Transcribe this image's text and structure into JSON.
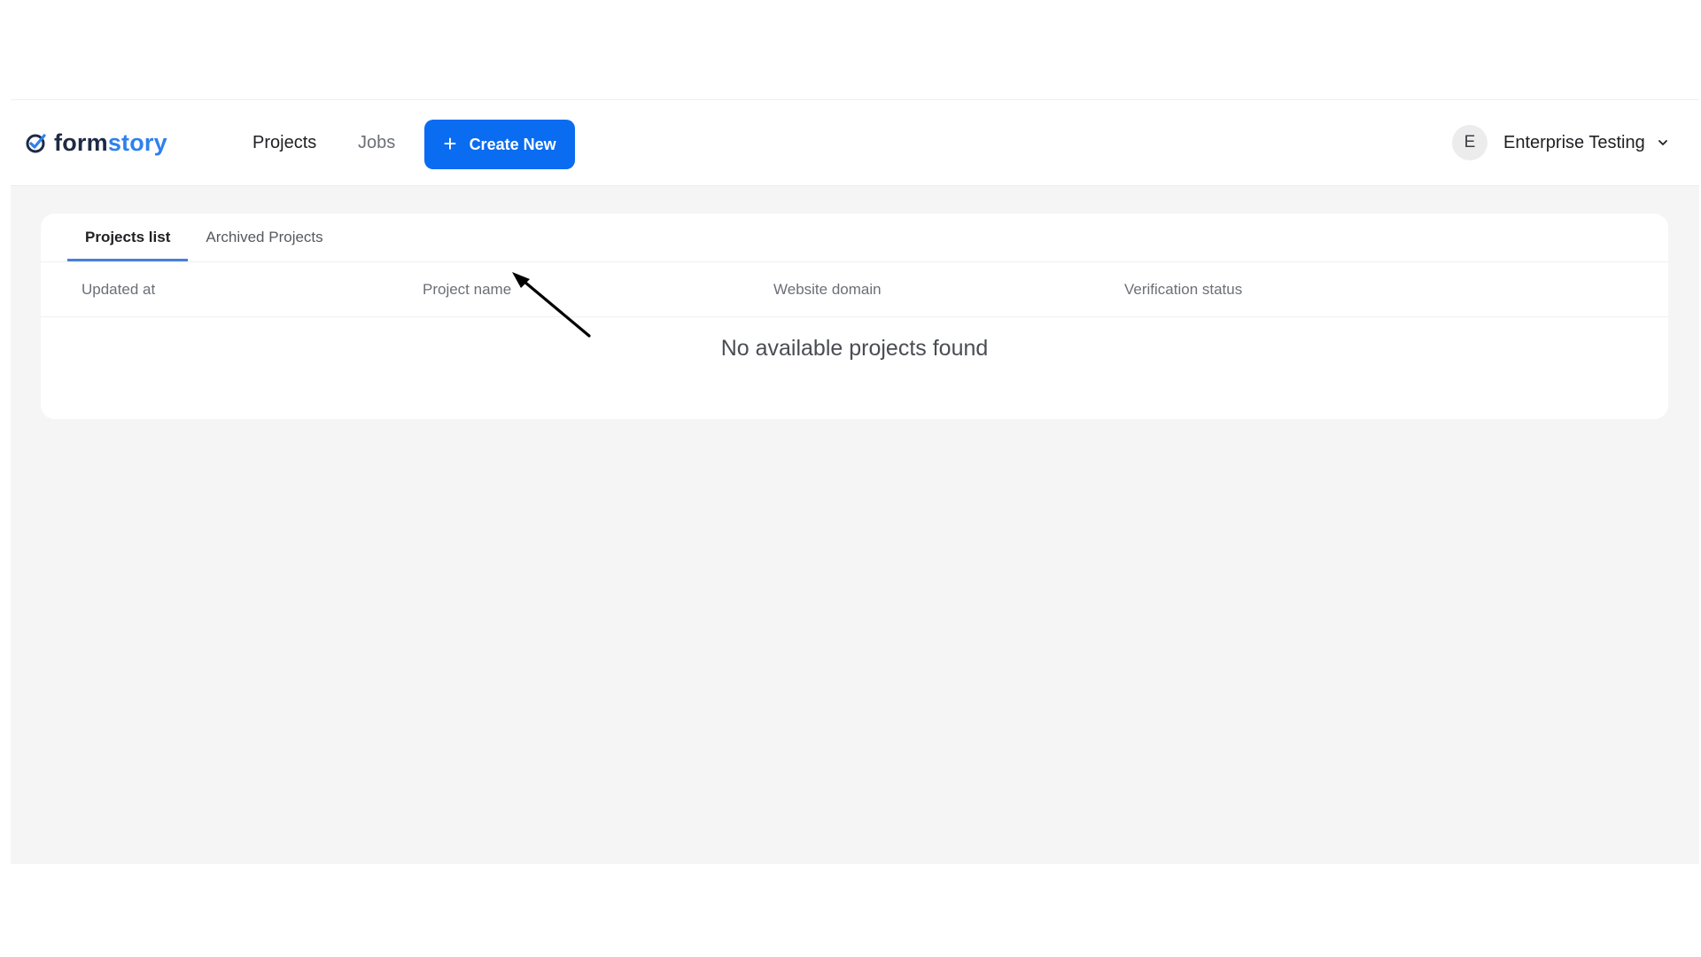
{
  "app": {
    "brand_part1": "form",
    "brand_part2": "story",
    "logo_icon": "formstory-check-icon",
    "brand_colors": {
      "dark": "#1f2a44",
      "accent": "#2f80ed"
    }
  },
  "nav": {
    "projects": "Projects",
    "jobs": "Jobs",
    "create_button": {
      "icon": "plus-icon",
      "icon_glyph": "+",
      "label": "Create New",
      "color": "#0a6cf0"
    }
  },
  "user": {
    "avatar_initial": "E",
    "name": "Enterprise Testing",
    "dropdown_icon": "chevron-down-icon"
  },
  "tabs": [
    {
      "label": "Projects list",
      "active": true
    },
    {
      "label": "Archived Projects",
      "active": false
    }
  ],
  "table": {
    "columns": [
      "Updated at",
      "Project name",
      "Website domain",
      "Verification status"
    ],
    "rows": [],
    "empty_message": "No available projects found"
  },
  "annotation": {
    "icon": "pointer-arrow-icon",
    "target": "Create New"
  }
}
